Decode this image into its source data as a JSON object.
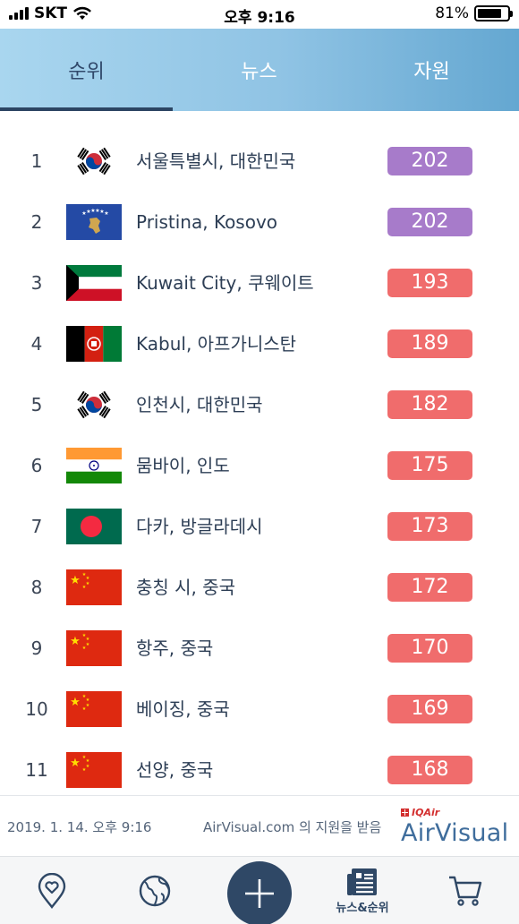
{
  "status_bar": {
    "carrier": "SKT",
    "time": "오후 9:16",
    "battery": "81%",
    "battery_level": 0.81
  },
  "tabs": [
    {
      "label": "순위",
      "active": true
    },
    {
      "label": "뉴스",
      "active": false
    },
    {
      "label": "자원",
      "active": false
    }
  ],
  "colors": {
    "aqi_purple": "#a77bca",
    "aqi_red": "#f06c6c",
    "navy": "#2f4866"
  },
  "rankings": [
    {
      "rank": "1",
      "city": "서울특별시, 대한민국",
      "aqi": "202",
      "flag": "south-korea",
      "level": "purple"
    },
    {
      "rank": "2",
      "city": "Pristina, Kosovo",
      "aqi": "202",
      "flag": "kosovo",
      "level": "purple"
    },
    {
      "rank": "3",
      "city": "Kuwait City, 쿠웨이트",
      "aqi": "193",
      "flag": "kuwait",
      "level": "red"
    },
    {
      "rank": "4",
      "city": "Kabul, 아프가니스탄",
      "aqi": "189",
      "flag": "afghanistan",
      "level": "red"
    },
    {
      "rank": "5",
      "city": "인천시, 대한민국",
      "aqi": "182",
      "flag": "south-korea",
      "level": "red"
    },
    {
      "rank": "6",
      "city": "뭄바이, 인도",
      "aqi": "175",
      "flag": "india",
      "level": "red"
    },
    {
      "rank": "7",
      "city": "다카, 방글라데시",
      "aqi": "173",
      "flag": "bangladesh",
      "level": "red"
    },
    {
      "rank": "8",
      "city": "충칭 시, 중국",
      "aqi": "172",
      "flag": "china",
      "level": "red"
    },
    {
      "rank": "9",
      "city": "항주, 중국",
      "aqi": "170",
      "flag": "china",
      "level": "red"
    },
    {
      "rank": "10",
      "city": "베이징, 중국",
      "aqi": "169",
      "flag": "china",
      "level": "red"
    },
    {
      "rank": "11",
      "city": "선양, 중국",
      "aqi": "168",
      "flag": "china",
      "level": "red"
    }
  ],
  "footer": {
    "date": "2019. 1. 14. 오후 9:16",
    "sponsor": "AirVisual.com 의 지원을 받음",
    "brand_small": "IQAir",
    "brand_name": "AirVisual"
  },
  "bottom_nav": {
    "items": [
      {
        "icon": "location-heart-icon"
      },
      {
        "icon": "globe-icon"
      },
      {
        "icon": "plus-icon"
      },
      {
        "icon": "news-icon",
        "label": "뉴스&순위"
      },
      {
        "icon": "cart-icon"
      }
    ]
  }
}
